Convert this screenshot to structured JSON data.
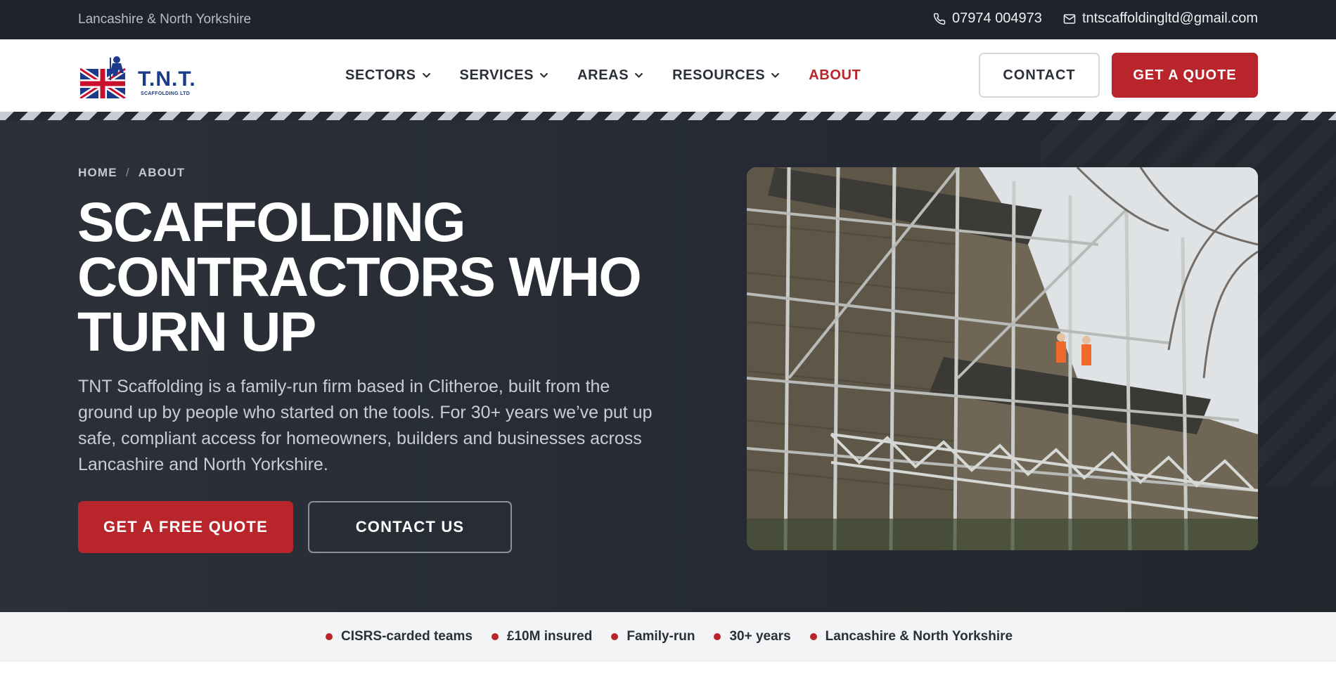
{
  "topbar": {
    "region": "Lancashire & North Yorkshire",
    "phone": "07974 004973",
    "email": "tntscaffoldingltd@gmail.com"
  },
  "header": {
    "logo_text": "T.N.T.",
    "logo_sub": "SCAFFOLDING LTD",
    "nav": [
      {
        "label": "SECTORS"
      },
      {
        "label": "SERVICES"
      },
      {
        "label": "AREAS"
      },
      {
        "label": "RESOURCES"
      },
      {
        "label": "ABOUT"
      }
    ],
    "contact_label": "CONTACT",
    "quote_label": "GET A QUOTE"
  },
  "hero": {
    "breadcrumb": {
      "home": "HOME",
      "sep": "/",
      "current": "ABOUT"
    },
    "title": "SCAFFOLDING CONTRACTORS WHO TURN UP",
    "text": "TNT Scaffolding is a family-run firm based in Clitheroe, built from the ground up by people who started on the tools. For 30+ years we’ve put up safe, compliant access for homeowners, builders and businesses across Lancashire and North Yorkshire.",
    "primary_cta": "GET A FREE QUOTE",
    "secondary_cta": "CONTACT US"
  },
  "trust": [
    "CISRS-carded teams",
    "£10M insured",
    "Family-run",
    "30+ years",
    "Lancashire & North Yorkshire"
  ],
  "colors": {
    "brand_red": "#b8252b",
    "dark": "#1f232b",
    "hero_bg": "#2c3139"
  }
}
